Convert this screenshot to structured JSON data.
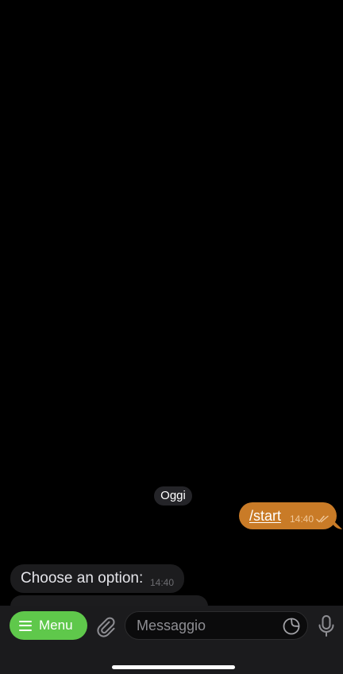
{
  "chat": {
    "date_label": "Oggi",
    "messages": [
      {
        "direction": "outgoing",
        "text": "/start",
        "time": "14:40",
        "status": "read"
      },
      {
        "direction": "incoming",
        "text": "Choose an option:",
        "time": "14:40"
      }
    ]
  },
  "composer": {
    "menu_label": "Menu",
    "input_placeholder": "Messaggio",
    "input_value": ""
  },
  "icons": {
    "menu": "hamburger-icon",
    "attach": "paperclip-icon",
    "sticker": "sticker-icon",
    "voice": "microphone-icon",
    "read_status": "double-check-icon"
  },
  "colors": {
    "background": "#000000",
    "outgoing_bubble": "#c97b27",
    "incoming_bubble": "#1c1c1e",
    "menu_button": "#5fc84b",
    "composer_bar": "#1b1b1d"
  }
}
